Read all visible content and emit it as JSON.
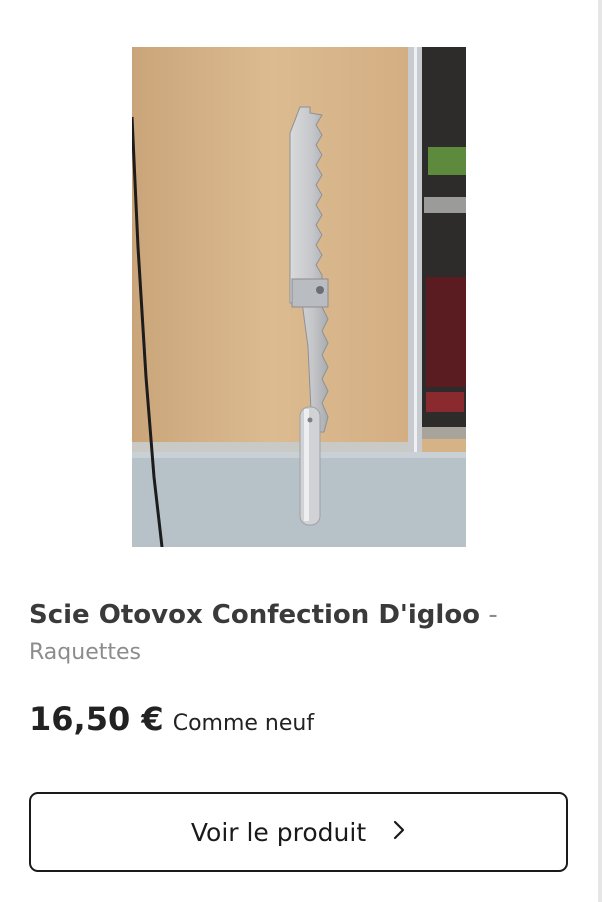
{
  "product": {
    "image_alt": "Scie Otovox Confection D'igloo",
    "title": "Scie Otovox Confection D'igloo",
    "title_separator": "-",
    "category": "Raquettes",
    "price": "16,50 €",
    "condition": "Comme neuf"
  },
  "cta": {
    "label": "Voir le produit",
    "icon": "chevron-right-icon"
  }
}
